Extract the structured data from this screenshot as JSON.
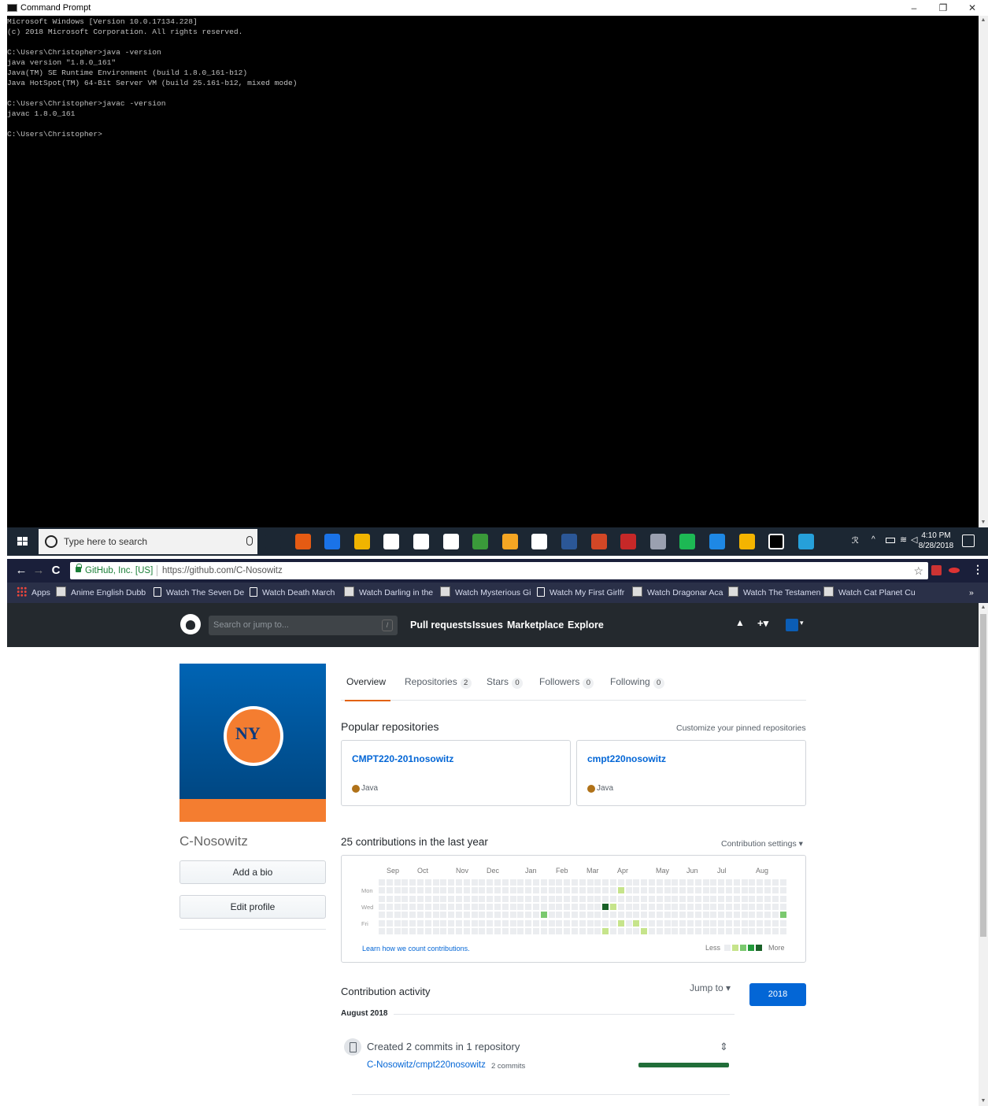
{
  "cmd": {
    "title": "Command Prompt",
    "min_glyph": "–",
    "max_glyph": "❐",
    "close_glyph": "✕",
    "lines": [
      "Microsoft Windows [Version 10.0.17134.228]",
      "(c) 2018 Microsoft Corporation. All rights reserved.",
      "",
      "C:\\Users\\Christopher>java -version",
      "java version \"1.8.0_161\"",
      "Java(TM) SE Runtime Environment (build 1.8.0_161-b12)",
      "Java HotSpot(TM) 64-Bit Server VM (build 25.161-b12, mixed mode)",
      "",
      "C:\\Users\\Christopher>javac -version",
      "javac 1.8.0_161",
      "",
      "C:\\Users\\Christopher>"
    ]
  },
  "taskbar": {
    "search_placeholder": "Type here to search",
    "time": "4:10 PM",
    "date": "8/28/2018",
    "icons": [
      "task-view-icon",
      "firefox-icon",
      "edge-icon",
      "file-explorer-icon",
      "store-icon",
      "settings-icon",
      "calculator-icon",
      "notepad-icon",
      "paint-icon",
      "sticky-notes-icon",
      "word-icon",
      "powerpoint-icon",
      "app-red-icon",
      "app-dark-icon",
      "app-green-icon",
      "app-blue-icon",
      "chrome-icon",
      "cmd-icon",
      "help-icon"
    ]
  },
  "chrome": {
    "back": "←",
    "forward": "→",
    "reload": "C",
    "site_org": "GitHub, Inc. [US]",
    "url": "https://github.com/C-Nosowitz",
    "star": "☆",
    "bookmarks": [
      {
        "label": "Apps",
        "icon": "apps"
      },
      {
        "label": "Anime English Dubb",
        "icon": "anime"
      },
      {
        "label": "Watch The Seven De",
        "icon": "page"
      },
      {
        "label": "Watch Death March",
        "icon": "page"
      },
      {
        "label": "Watch Darling in the",
        "icon": "anime"
      },
      {
        "label": "Watch Mysterious Gi",
        "icon": "anime"
      },
      {
        "label": "Watch My First Girlfr",
        "icon": "page"
      },
      {
        "label": "Watch Dragonar Aca",
        "icon": "anime"
      },
      {
        "label": "Watch The Testamen",
        "icon": "anime"
      },
      {
        "label": "Watch Cat Planet Cu",
        "icon": "anime"
      }
    ],
    "overflow": "»"
  },
  "github": {
    "search_placeholder": "Search or jump to...",
    "slash": "/",
    "nav": [
      "Pull requests",
      "Issues",
      "Marketplace",
      "Explore"
    ],
    "bell": "🔔",
    "plus": "+▾",
    "avatar_caret": "▾",
    "username": "C-Nosowitz",
    "avatar_text": "NY",
    "add_bio": "Add a bio",
    "edit_profile": "Edit profile",
    "tabs": [
      {
        "label": "Overview",
        "count": ""
      },
      {
        "label": "Repositories",
        "count": "2"
      },
      {
        "label": "Stars",
        "count": "0"
      },
      {
        "label": "Followers",
        "count": "0"
      },
      {
        "label": "Following",
        "count": "0"
      }
    ],
    "popular_title": "Popular repositories",
    "customize_link": "Customize your pinned repositories",
    "repos": [
      {
        "name": "CMPT220-201nosowitz",
        "lang": "Java"
      },
      {
        "name": "cmpt220nosowitz",
        "lang": "Java"
      }
    ],
    "contrib_title": "25 contributions in the last year",
    "contrib_settings": "Contribution settings ▾",
    "months": [
      "Sep",
      "Oct",
      "Nov",
      "Dec",
      "Jan",
      "Feb",
      "Mar",
      "Apr",
      "May",
      "Jun",
      "Jul",
      "Aug"
    ],
    "weekdays": [
      "Mon",
      "Wed",
      "Fri"
    ],
    "learn_link": "Learn how we count contributions.",
    "less": "Less",
    "more": "More",
    "activity_title": "Contribution activity",
    "jump_to": "Jump to ▾",
    "year": "2018",
    "month_label": "August 2018",
    "commit_title": "Created 2 commits in 1 repository",
    "commit_fold": "⇕",
    "commit_repo": "C-Nosowitz/cmpt220nosowitz",
    "commit_count": "2 commits"
  },
  "contributions": {
    "weeks": 53,
    "days": 7,
    "active": [
      {
        "week": 31,
        "day": 1,
        "level": 1
      },
      {
        "week": 21,
        "day": 4,
        "level": 2
      },
      {
        "week": 29,
        "day": 3,
        "level": 4
      },
      {
        "week": 30,
        "day": 3,
        "level": 1
      },
      {
        "week": 31,
        "day": 5,
        "level": 1
      },
      {
        "week": 33,
        "day": 5,
        "level": 1
      },
      {
        "week": 34,
        "day": 6,
        "level": 1
      },
      {
        "week": 29,
        "day": 6,
        "level": 1
      },
      {
        "week": 52,
        "day": 4,
        "level": 2
      }
    ],
    "colors": [
      "#ebedf0",
      "#c6e48b",
      "#7bc96f",
      "#239a3b",
      "#196127"
    ]
  }
}
